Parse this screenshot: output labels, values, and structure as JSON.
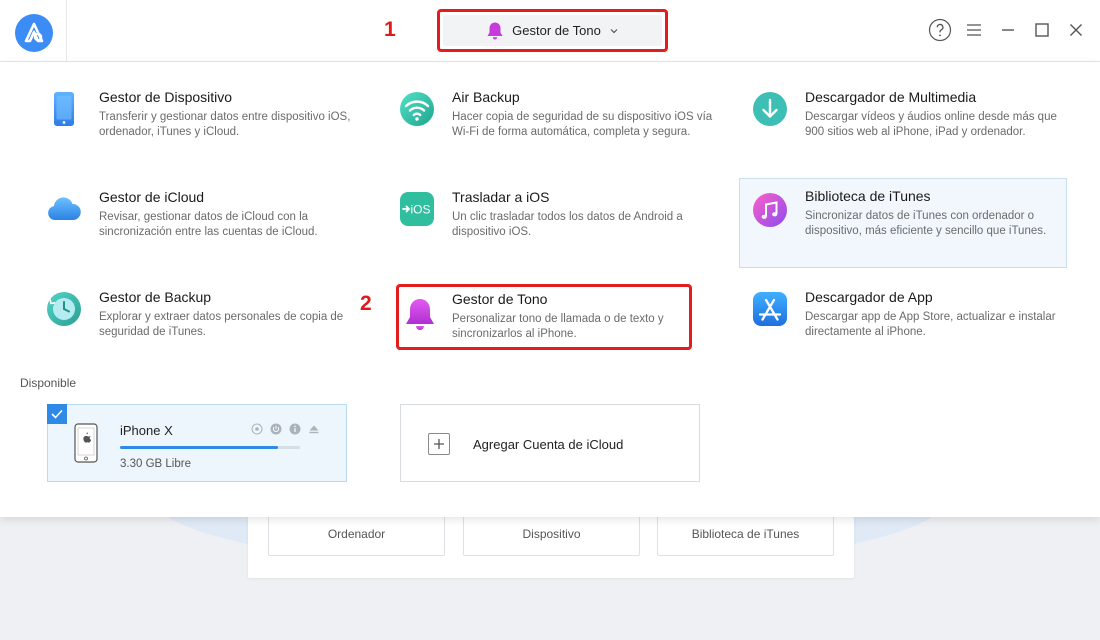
{
  "header": {
    "mode_selector": {
      "label": "Gestor de Tono",
      "icon": "bell-icon"
    },
    "annotation_1": "1",
    "window_controls": [
      "help-icon",
      "menu-icon",
      "minimize-icon",
      "maximize-icon",
      "close-icon"
    ]
  },
  "features": [
    {
      "title": "Gestor de Dispositivo",
      "description": "Transferir y gestionar datos entre dispositivo iOS, ordenador, iTunes y iCloud.",
      "icon": "phone-icon"
    },
    {
      "title": "Air Backup",
      "description": "Hacer copia de seguridad de su dispositivo iOS vía Wi-Fi de forma automática, completa y segura.",
      "icon": "wifi-icon"
    },
    {
      "title": "Descargador de Multimedia",
      "description": "Descargar vídeos y áudios online desde más que 900 sitios web al iPhone, iPad y ordenador.",
      "icon": "download-icon"
    },
    {
      "title": "Gestor de iCloud",
      "description": "Revisar, gestionar datos de iCloud con la sincronización entre las cuentas de iCloud.",
      "icon": "cloud-icon"
    },
    {
      "title": "Trasladar a iOS",
      "description": "Un clic trasladar todos los datos de Android a dispositivo iOS.",
      "icon": "move-to-ios-icon"
    },
    {
      "title": "Biblioteca de iTunes",
      "description": "Sincronizar datos de iTunes con ordenador o dispositivo, más eficiente y sencillo que iTunes.",
      "icon": "music-icon"
    },
    {
      "title": "Gestor de Backup",
      "description": "Explorar y extraer datos personales de copia de seguridad de iTunes.",
      "icon": "backup-clock-icon"
    },
    {
      "title": "Gestor de Tono",
      "description": "Personalizar tono de llamada o de texto y sincronizarlos al iPhone.",
      "icon": "bell-icon"
    },
    {
      "title": "Descargador de App",
      "description": "Descargar app de App Store, actualizar e instalar directamente al iPhone.",
      "icon": "app-store-icon"
    }
  ],
  "annotation_2": "2",
  "available": {
    "label": "Disponible",
    "device": {
      "name": "iPhone X",
      "storage": "3.30 GB Libre",
      "storage_used_fraction": 0.88
    },
    "add_icloud": "Agregar Cuenta de iCloud"
  },
  "background": {
    "buttons": [
      "Ordenador",
      "Dispositivo",
      "Biblioteca de iTunes"
    ]
  },
  "colors": {
    "accent": "#2e8ae6",
    "highlight_frame": "#e31d1d",
    "ringtone_purple": "#c53bdc"
  }
}
